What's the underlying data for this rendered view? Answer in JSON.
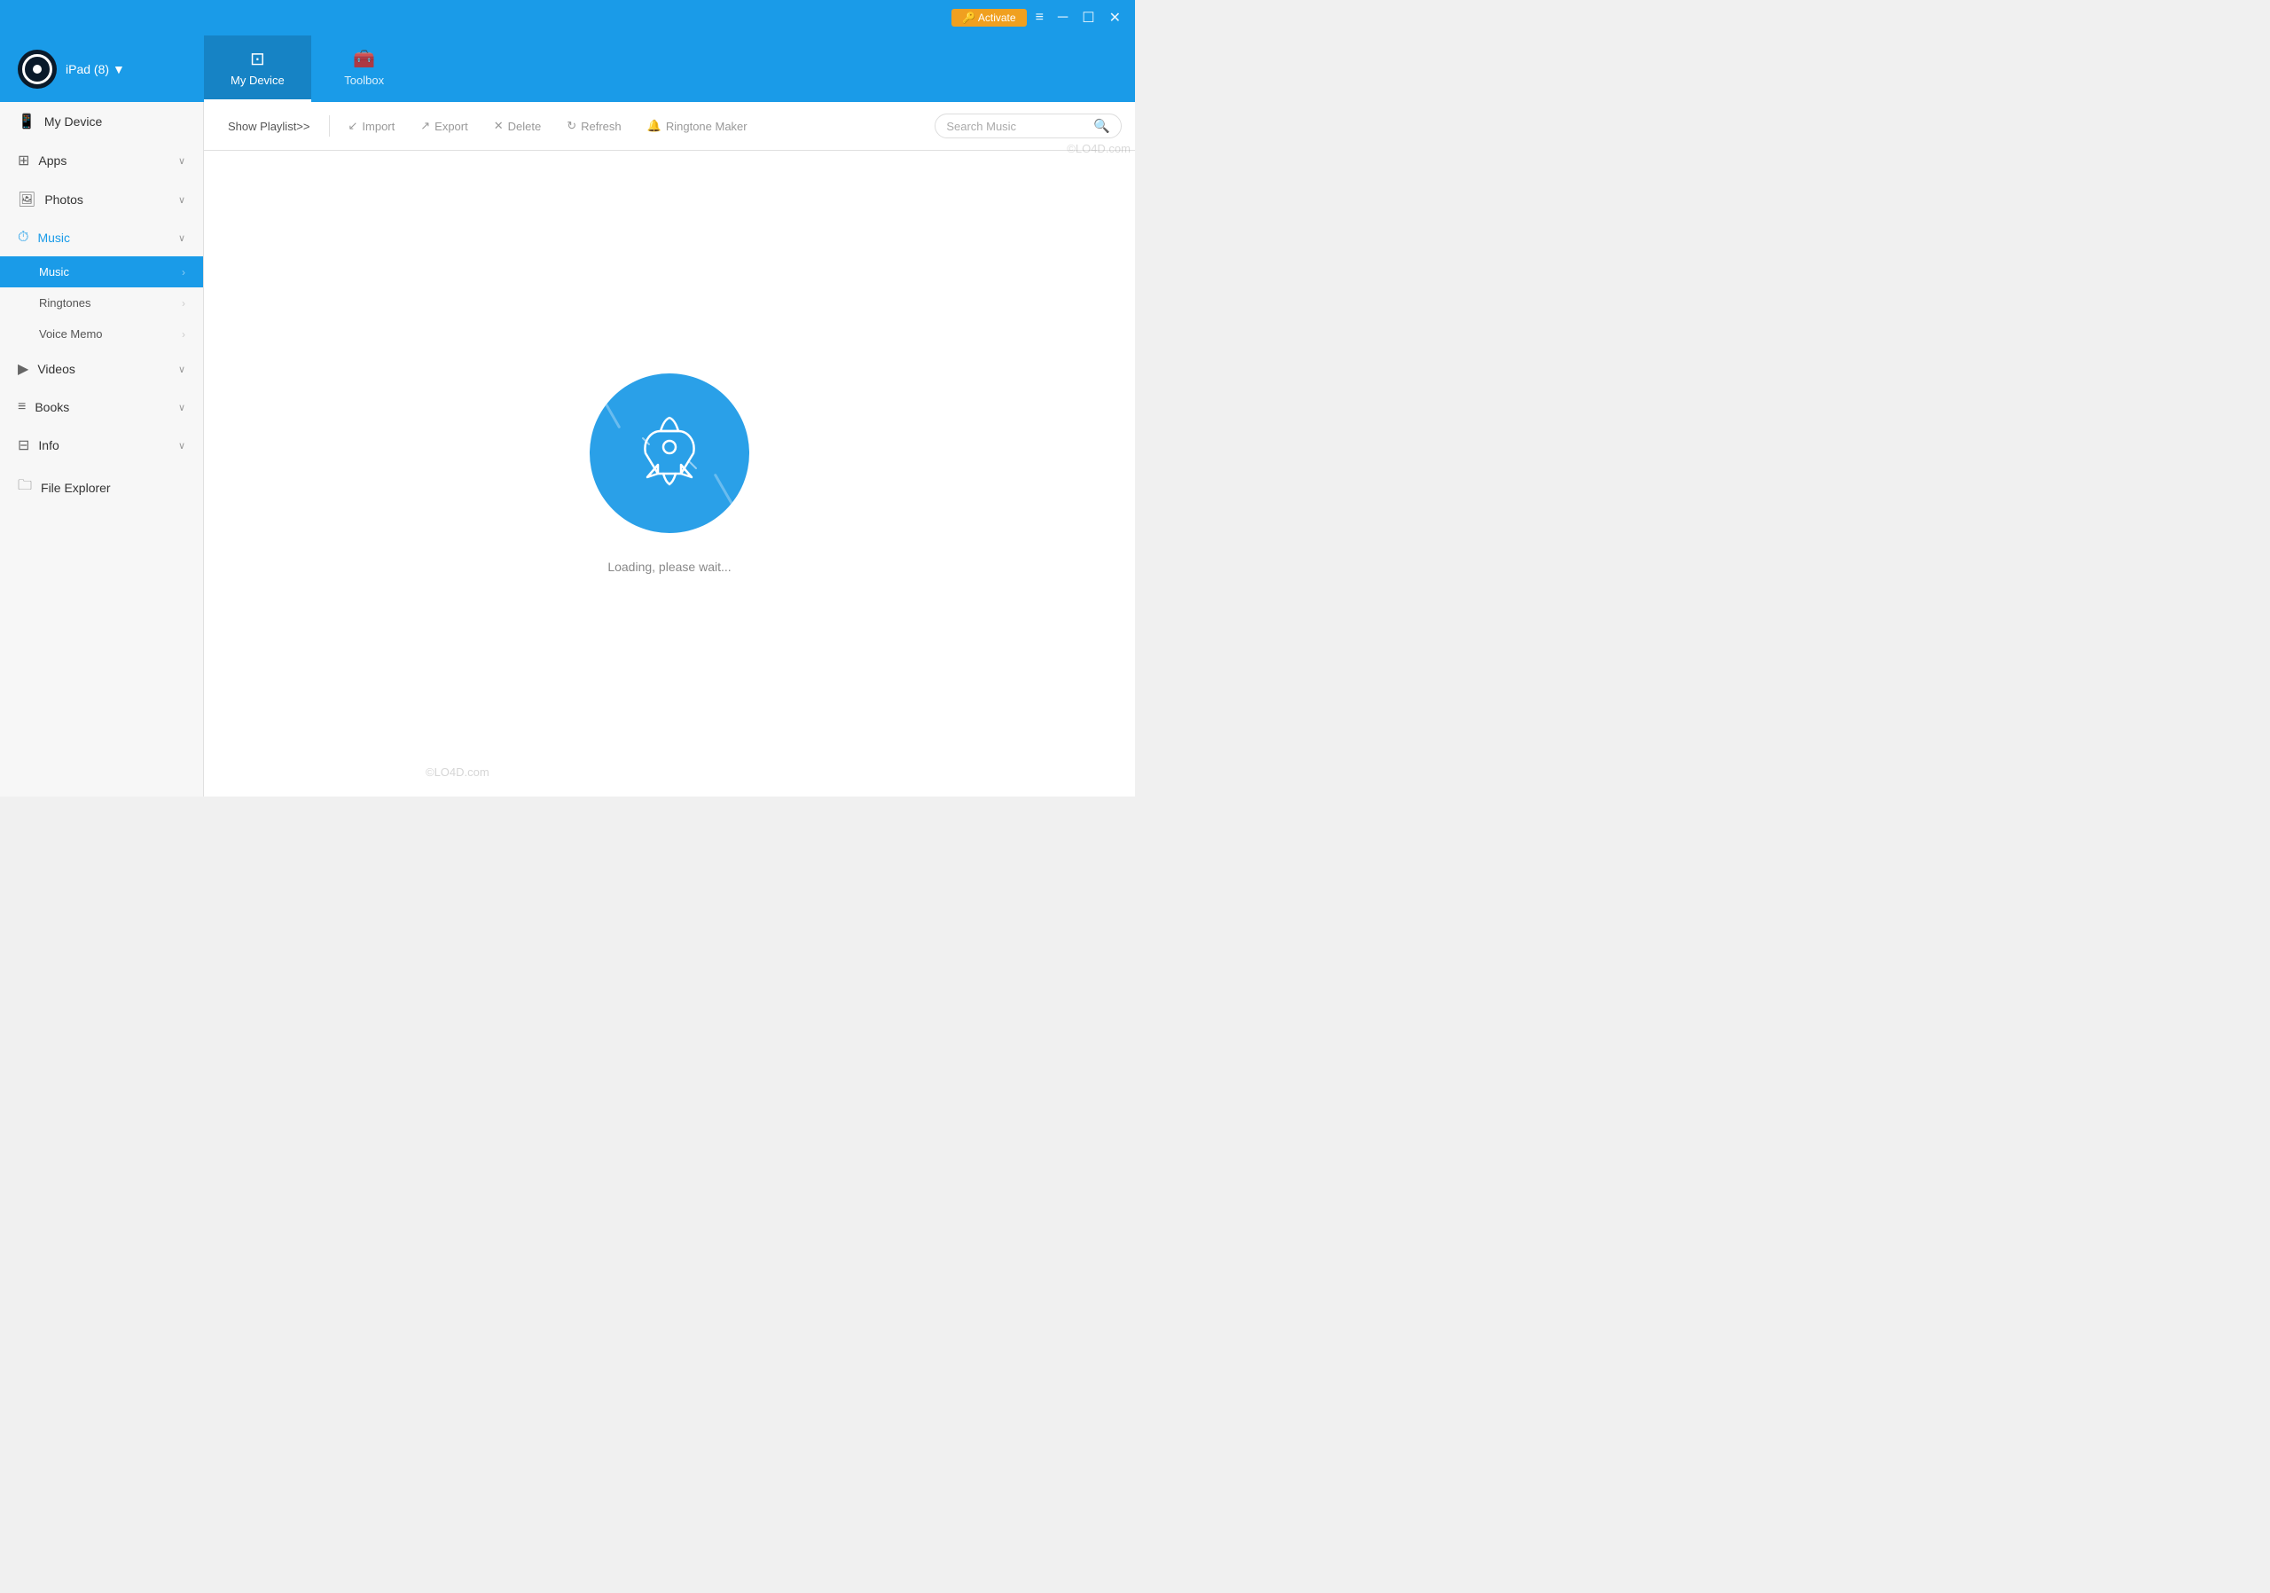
{
  "titlebar": {
    "activate_label": "🔑 Activate",
    "menu_icon": "≡",
    "minimize_icon": "─",
    "maximize_icon": "☐",
    "close_icon": "✕"
  },
  "header": {
    "device_name": "iPad (8)",
    "device_arrow": "▼",
    "tabs": [
      {
        "id": "my-device",
        "label": "My Device",
        "icon": "⊡",
        "active": true
      },
      {
        "id": "toolbox",
        "label": "Toolbox",
        "icon": "🧰",
        "active": false
      }
    ]
  },
  "sidebar": {
    "items": [
      {
        "id": "my-device",
        "icon": "📱",
        "label": "My Device",
        "has_chevron": false
      },
      {
        "id": "apps",
        "icon": "⊞",
        "label": "Apps",
        "has_chevron": true
      },
      {
        "id": "photos",
        "icon": "🖼",
        "label": "Photos",
        "has_chevron": true
      },
      {
        "id": "music",
        "icon": "⏱",
        "label": "Music",
        "has_chevron": true,
        "active_parent": true
      },
      {
        "id": "videos",
        "icon": "▶",
        "label": "Videos",
        "has_chevron": true
      },
      {
        "id": "books",
        "icon": "≡",
        "label": "Books",
        "has_chevron": true
      },
      {
        "id": "info",
        "icon": "⊟",
        "label": "Info",
        "has_chevron": true
      },
      {
        "id": "file-explorer",
        "icon": "🗀",
        "label": "File Explorer",
        "has_chevron": false
      }
    ],
    "sub_items": [
      {
        "id": "music-sub",
        "label": "Music",
        "active": true
      },
      {
        "id": "ringtones",
        "label": "Ringtones"
      },
      {
        "id": "voice-memo",
        "label": "Voice Memo"
      }
    ]
  },
  "toolbar": {
    "show_playlist_label": "Show Playlist>>",
    "import_label": "Import",
    "export_label": "Export",
    "delete_label": "Delete",
    "refresh_label": "Refresh",
    "ringtone_maker_label": "Ringtone Maker",
    "search_placeholder": "Search Music"
  },
  "main": {
    "loading_text": "Loading, please wait..."
  },
  "watermark": {
    "text1": "©LO4D.com",
    "text2": "©LO4D.com"
  }
}
